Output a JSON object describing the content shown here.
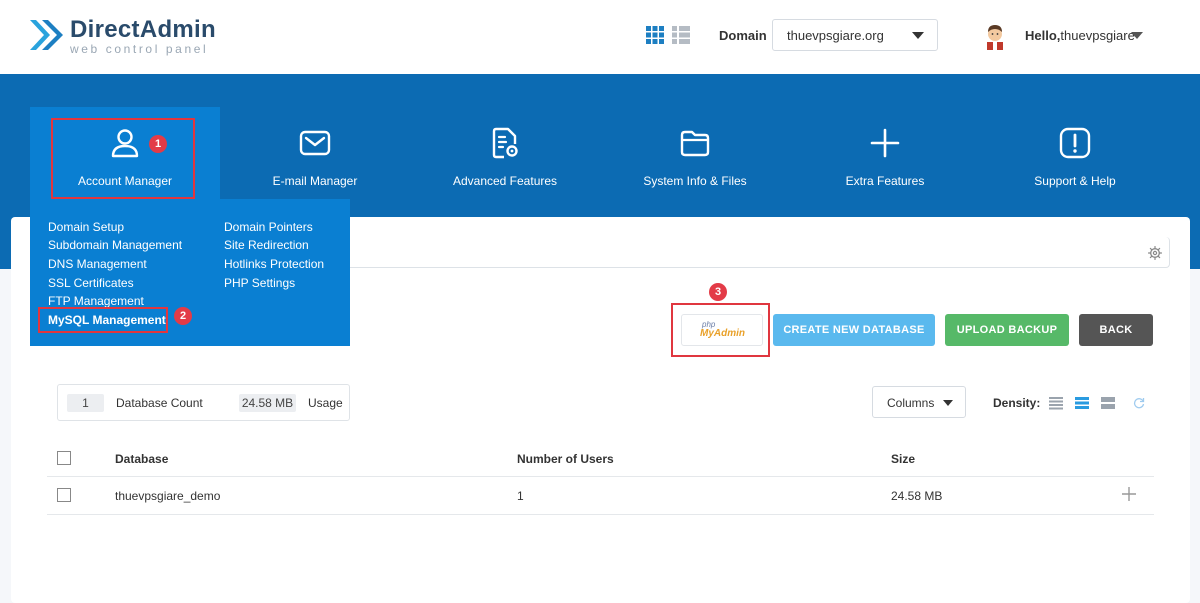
{
  "brand": {
    "title": "DirectAdmin",
    "subtitle": "web control panel"
  },
  "header": {
    "domain_label": "Domain",
    "domain_value": "thuevpsgiare.org",
    "greeting": "Hello,",
    "username": "thuevpsgiare"
  },
  "nav": [
    {
      "label": "Account Manager",
      "icon": "user-icon"
    },
    {
      "label": "E-mail Manager",
      "icon": "envelope-icon"
    },
    {
      "label": "Advanced Features",
      "icon": "document-gear-icon"
    },
    {
      "label": "System Info & Files",
      "icon": "folder-icon"
    },
    {
      "label": "Extra Features",
      "icon": "plus-icon"
    },
    {
      "label": "Support & Help",
      "icon": "alert-icon"
    }
  ],
  "dropdown": {
    "left": [
      "Domain Setup",
      "Subdomain Management",
      "DNS Management",
      "SSL Certificates",
      "FTP Management",
      "MySQL Management"
    ],
    "right": [
      "Domain Pointers",
      "Site Redirection",
      "Hotlinks Protection",
      "PHP Settings"
    ]
  },
  "badges": [
    "1",
    "2",
    "3"
  ],
  "actions": {
    "pma_php": "php",
    "pma_admin": "MyAdmin",
    "create": "CREATE NEW DATABASE",
    "upload": "UPLOAD BACKUP",
    "back": "BACK"
  },
  "stats": {
    "count": "1",
    "count_label": "Database Count",
    "usage": "24.58 MB",
    "usage_label": "Usage"
  },
  "toolbar": {
    "columns": "Columns",
    "density": "Density:"
  },
  "table": {
    "headers": [
      "Database",
      "Number of Users",
      "Size"
    ],
    "rows": [
      {
        "database": "thuevpsgiare_demo",
        "users": "1",
        "size": "24.58 MB"
      }
    ]
  },
  "colors": {
    "brand_blue": "#0c6bb3",
    "menu_blue": "#0a7fd2",
    "highlight_red": "#e0363f",
    "create_btn": "#5ab9ee",
    "upload_btn": "#56b968",
    "back_btn": "#555555"
  }
}
